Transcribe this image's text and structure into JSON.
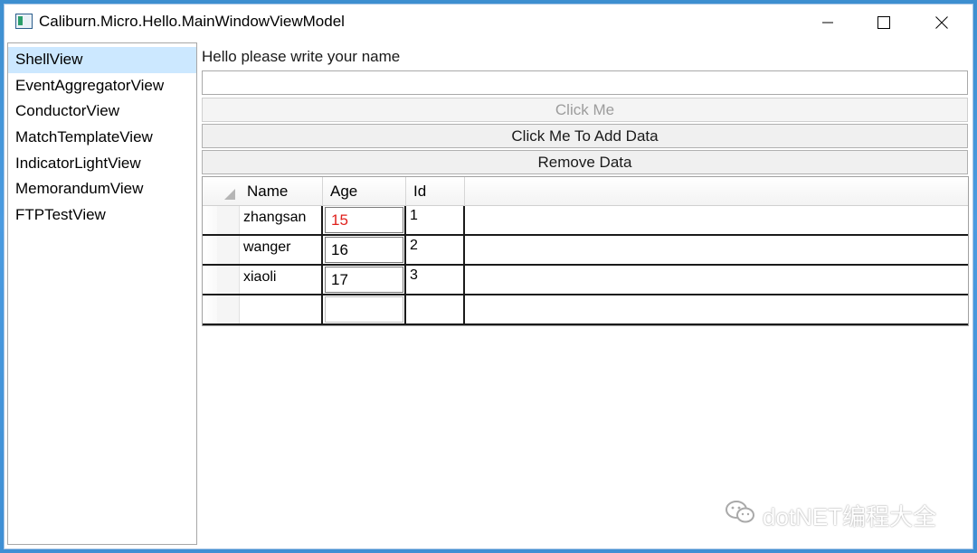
{
  "window": {
    "title": "Caliburn.Micro.Hello.MainWindowViewModel"
  },
  "sidebar": {
    "items": [
      {
        "label": "ShellView",
        "selected": true
      },
      {
        "label": "EventAggregatorView",
        "selected": false
      },
      {
        "label": "ConductorView",
        "selected": false
      },
      {
        "label": "MatchTemplateView",
        "selected": false
      },
      {
        "label": "IndicatorLightView",
        "selected": false
      },
      {
        "label": "MemorandumView",
        "selected": false
      },
      {
        "label": "FTPTestView",
        "selected": false
      }
    ]
  },
  "main": {
    "greeting": "Hello please write your name",
    "name_input": {
      "value": ""
    },
    "click_me_label": "Click Me",
    "add_data_label": "Click Me To Add Data",
    "remove_data_label": "Remove Data",
    "grid": {
      "columns": [
        "Name",
        "Age",
        "Id"
      ],
      "rows": [
        {
          "name": "zhangsan",
          "age": "15",
          "id": "1",
          "age_invalid": true
        },
        {
          "name": "wanger",
          "age": "16",
          "id": "2"
        },
        {
          "name": "xiaoli",
          "age": "17",
          "id": "3"
        },
        {
          "name": "",
          "age": "",
          "id": ""
        }
      ]
    }
  },
  "watermark": {
    "text": "dotNET编程大全",
    "icon": "wechat-icon"
  },
  "colors": {
    "selection": "#cce8ff",
    "invalid_text": "#e0201c",
    "desktop": "#4b9be0"
  }
}
